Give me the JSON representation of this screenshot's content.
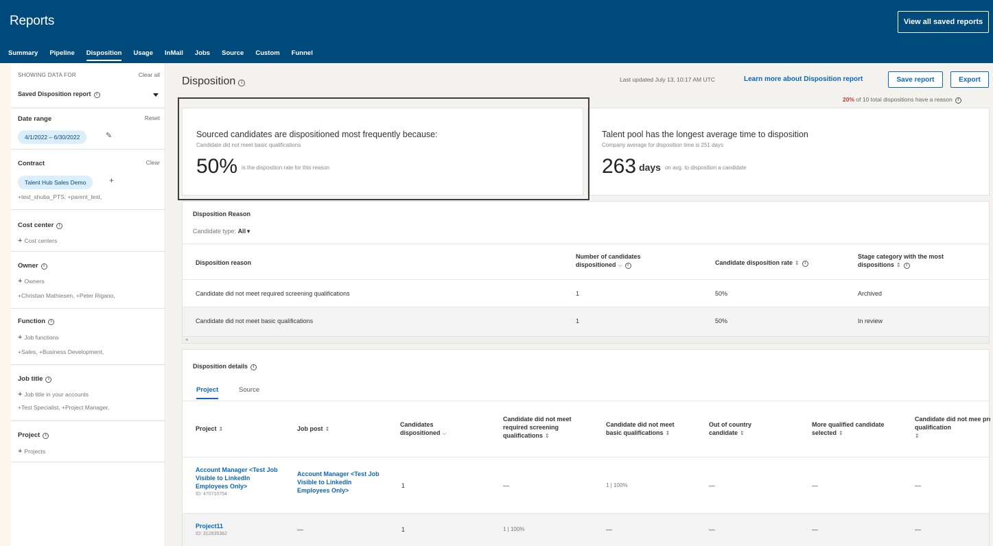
{
  "header": {
    "title": "Reports",
    "view_all_label": "View all saved reports",
    "tabs": [
      "Summary",
      "Pipeline",
      "Disposition",
      "Usage",
      "InMail",
      "Jobs",
      "Source",
      "Custom",
      "Funnel"
    ],
    "active_tab": "Disposition"
  },
  "sidebar": {
    "showing_label": "SHOWING DATA FOR",
    "clear_all": "Clear all",
    "saved_report": "Saved Disposition report",
    "date_range": {
      "label": "Date range",
      "reset": "Reset",
      "value": "4/1/2022 – 6/30/2022"
    },
    "contract": {
      "label": "Contract",
      "clear": "Clear",
      "pill": "Talent Hub Sales Demo",
      "extra": "+test_shuba_PTS, +parent_test,"
    },
    "cost_center": {
      "label": "Cost center",
      "add": "Cost centers"
    },
    "owner": {
      "label": "Owner",
      "add": "Owners",
      "selected": "+Christian Mathiesen, +Peter Rigano,"
    },
    "function": {
      "label": "Function",
      "add": "Job functions",
      "selected": "+Sales, +Business Development,"
    },
    "job_title": {
      "label": "Job title",
      "add": "Job title in your accounts",
      "selected": "+Test Specialist, +Project Manager,"
    },
    "project": {
      "label": "Project",
      "add": "Projects"
    }
  },
  "main": {
    "title": "Disposition",
    "last_updated": "Last updated July 13, 10:17 AM UTC",
    "learn_more": "Learn more about Disposition report",
    "save_label": "Save report",
    "export_label": "Export",
    "reason_note_pct": "20%",
    "reason_note_rest": "of 10 total dispositions have a reason"
  },
  "cards": [
    {
      "title": "Sourced candidates are dispositioned most frequently because:",
      "sub": "Candidate did not meet basic qualifications",
      "big": "50%",
      "big_caption": "is the disposition rate for this reason"
    },
    {
      "title": "Talent pool has the longest average time to disposition",
      "sub": "Company average for disposition time is 251 days",
      "big": "263",
      "unit": "days",
      "big_caption": "on avg. to disposition a candidate"
    }
  ],
  "reason_table": {
    "title": "Disposition Reason",
    "filter_label": "Candidate type:",
    "filter_value": "All",
    "columns": [
      "Disposition reason",
      "Number of candidates dispositioned",
      "Candidate disposition rate",
      "Stage category with the most dispositions"
    ],
    "rows": [
      [
        "Candidate did not meet required screening qualifications",
        "1",
        "50%",
        "Archived"
      ],
      [
        "Candidate did not meet basic qualifications",
        "1",
        "50%",
        "In review"
      ]
    ]
  },
  "details_table": {
    "title": "Disposition details",
    "tabs": [
      "Project",
      "Source"
    ],
    "columns": [
      "Project",
      "Job post",
      "Candidates dispositioned",
      "Candidate did not meet required screening qualifications",
      "Candidate did not meet basic qualifications",
      "Out of country candidate",
      "More qualified candidate selected",
      "Candidate did not mee preferred qualification"
    ],
    "rows": [
      {
        "project": "Account Manager <Test Job Visible to LinkedIn Employees Only>",
        "project_id": "ID: 470710754",
        "job_post": "Account Manager <Test Job Visible to LinkedIn Employees Only>",
        "values": [
          "1",
          "—",
          "1 | 100%",
          "—",
          "—",
          "—"
        ]
      },
      {
        "project": "Project11",
        "project_id": "ID: 312835362",
        "job_post": "—",
        "values": [
          "1",
          "1 | 100%",
          "—",
          "—",
          "—",
          "—"
        ]
      }
    ]
  }
}
